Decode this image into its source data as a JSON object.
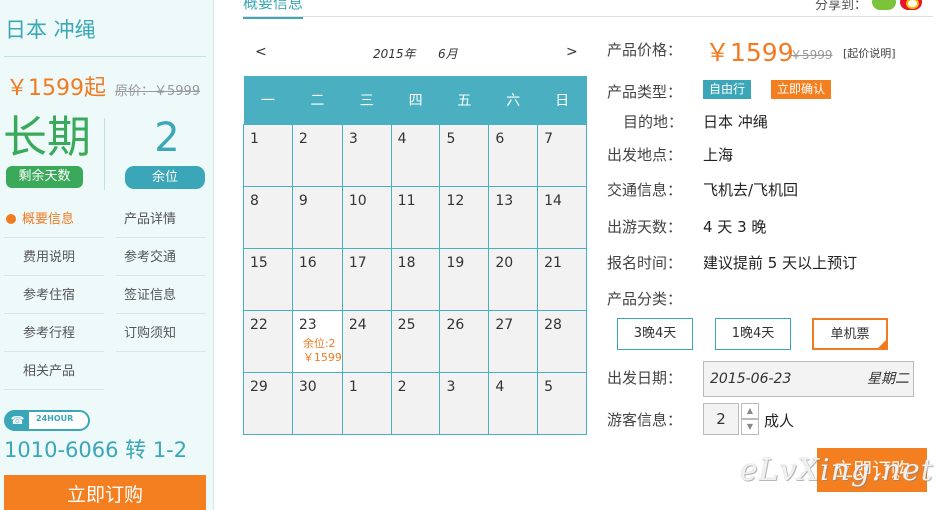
{
  "sidebar": {
    "title": "日本 冲绳",
    "price": "￥1599起",
    "orig_price": "原价：￥5999",
    "days_value": "长期",
    "days_label": "剩余天数",
    "seats_value": "2",
    "seats_label": "余位",
    "nav": [
      {
        "label": "概要信息"
      },
      {
        "label": "产品详情"
      },
      {
        "label": "费用说明"
      },
      {
        "label": "参考交通"
      },
      {
        "label": "参考住宿"
      },
      {
        "label": "签证信息"
      },
      {
        "label": "参考行程"
      },
      {
        "label": "订购须知"
      },
      {
        "label": "相关产品"
      }
    ],
    "phone_badge": "24HOUR",
    "phone": "1010-6066 转 1-2",
    "book_label": "立即订购"
  },
  "tabs": {
    "overview": "概要信息",
    "share_label": "分享到："
  },
  "calendar": {
    "prev": "<",
    "next": ">",
    "year": "2015年",
    "month": "6月",
    "weekdays": [
      "一",
      "二",
      "三",
      "四",
      "五",
      "六",
      "日"
    ],
    "weeks": [
      [
        "1",
        "2",
        "3",
        "4",
        "5",
        "6",
        "7"
      ],
      [
        "8",
        "9",
        "10",
        "11",
        "12",
        "13",
        "14"
      ],
      [
        "15",
        "16",
        "17",
        "18",
        "19",
        "20",
        "21"
      ],
      [
        "22",
        "23",
        "24",
        "25",
        "26",
        "27",
        "28"
      ],
      [
        "29",
        "30",
        "1",
        "2",
        "3",
        "4",
        "5"
      ]
    ],
    "special": {
      "day": "23",
      "seats": "余位:2",
      "price": "￥1599"
    }
  },
  "info": {
    "price_label": "产品价格：",
    "price": "￥1599",
    "orig_price": "￥5999",
    "price_note": "[起价说明]",
    "type_label": "产品类型：",
    "tag1": "自由行",
    "tag2": "立即确认",
    "dest_label": "目的地：",
    "dest": "日本 冲绳",
    "depart_label": "出发地点：",
    "depart": "上海",
    "traffic_label": "交通信息：",
    "traffic": "飞机去/飞机回",
    "duration_label": "出游天数：",
    "duration": "4 天 3 晚",
    "signup_label": "报名时间：",
    "signup": "建议提前 5 天以上预订",
    "category_label": "产品分类：",
    "categories": [
      "3晚4天",
      "1晚4天",
      "单机票"
    ],
    "date_label": "出发日期：",
    "date": "2015-06-23",
    "weekday": "星期二",
    "tourist_label": "游客信息：",
    "qty": "2",
    "qty_unit": "成人",
    "book_label": "立即订购"
  },
  "watermark": "eLvXing.net"
}
